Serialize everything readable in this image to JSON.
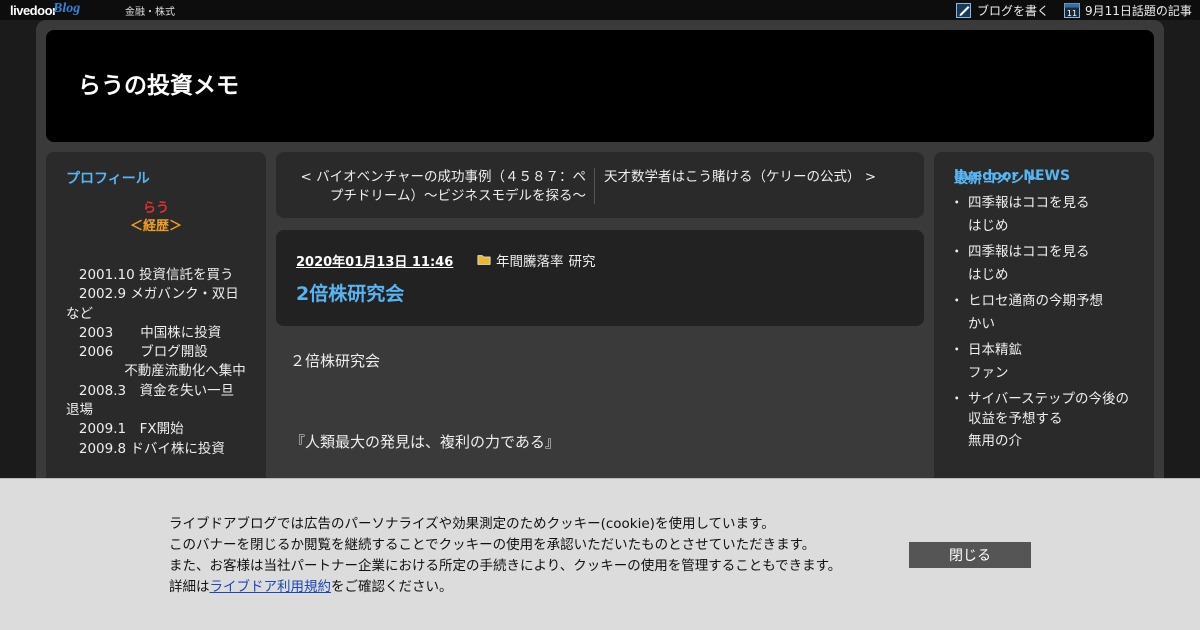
{
  "topbar": {
    "logo_text": "livedoor",
    "logo_blog": "Blog",
    "category": "金融・株式",
    "write_label": "ブログを書く",
    "today_label": "9月11日話題の記事",
    "calendar_day": "11"
  },
  "header": {
    "title": "らうの投資メモ"
  },
  "profile": {
    "heading": "プロフィール",
    "name": "らう",
    "career_label": "＜経歴＞",
    "history": "   2001.10 投資信託を買う\n   2002.9 メガバンク・双日など\n   2003　　中国株に投資\n   2006　　ブログ開設\n　　　　 不動産流動化へ集中\n   2008.3　資金を失い一旦退場\n   2009.1　FX開始\n   2009.8 ドバイ株に投資"
  },
  "nav": {
    "prev": "< バイオベンチャーの成功事例（４５８７：ペプチドリーム）～ビジネスモデルを探る～",
    "next": "天才数学者はこう賭ける（ケリーの公式） >"
  },
  "post": {
    "date": "2020年01月13日 11:46",
    "categories": [
      "年間騰落率",
      "研究"
    ],
    "title": "2倍株研究会",
    "paragraphs": [
      "２倍株研究会",
      "『人類最大の発見は、複利の力である』"
    ]
  },
  "recent_comments": {
    "heading": "最新コメント",
    "items": [
      {
        "title": "四季報はココを見る",
        "author": "はじめ"
      },
      {
        "title": "四季報はココを見る",
        "author": "はじめ"
      },
      {
        "title": "ヒロセ通商の今期予想",
        "author": "かい"
      },
      {
        "title": "日本精鉱",
        "author": "ファン"
      },
      {
        "title": "サイバーステップの今後の収益を予想する",
        "author": "無用の介"
      }
    ]
  },
  "news": {
    "heading": "livedoor NEWS"
  },
  "cookie": {
    "line1": "ライブドアブログでは広告のパーソナライズや効果測定のためクッキー(cookie)を使用しています。",
    "line2": "このバナーを閉じるか閲覧を継続することでクッキーの使用を承認いただいたものとさせていただきます。",
    "line3": "また、お客様は当社パートナー企業における所定の手続きにより、クッキーの使用を管理することもできます。",
    "line4_prefix": "詳細は",
    "line4_link": "ライブドア利用規約",
    "line4_suffix": "をご確認ください。",
    "close_label": "閉じる"
  },
  "colors": {
    "accent_blue": "#58b4f0",
    "author_red": "#e23030",
    "career_orange": "#f0a020",
    "banner_bg": "#dcdcdc"
  },
  "icons": [
    "pencil-icon",
    "calendar-icon",
    "folder-icon"
  ]
}
